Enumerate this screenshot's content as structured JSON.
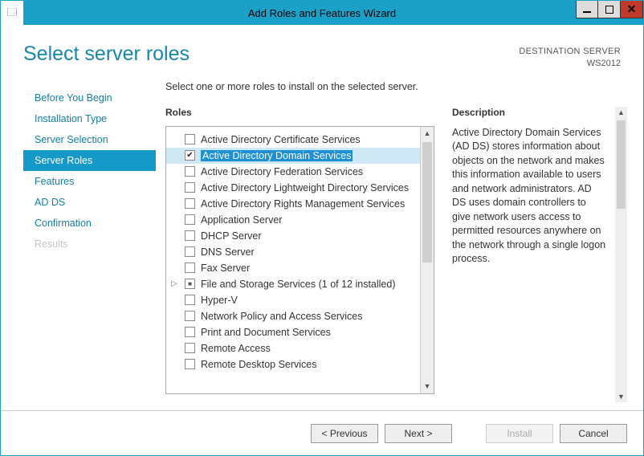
{
  "titlebar": {
    "title": "Add Roles and Features Wizard"
  },
  "header": {
    "page_title": "Select server roles",
    "destination_label": "DESTINATION SERVER",
    "destination_value": "WS2012"
  },
  "nav": {
    "items": [
      {
        "label": "Before You Begin",
        "active": false,
        "disabled": false
      },
      {
        "label": "Installation Type",
        "active": false,
        "disabled": false
      },
      {
        "label": "Server Selection",
        "active": false,
        "disabled": false
      },
      {
        "label": "Server Roles",
        "active": true,
        "disabled": false
      },
      {
        "label": "Features",
        "active": false,
        "disabled": false
      },
      {
        "label": "AD DS",
        "active": false,
        "disabled": false
      },
      {
        "label": "Confirmation",
        "active": false,
        "disabled": false
      },
      {
        "label": "Results",
        "active": false,
        "disabled": true
      }
    ]
  },
  "main": {
    "instruction": "Select one or more roles to install on the selected server.",
    "roles_label": "Roles",
    "description_label": "Description",
    "description_text": "Active Directory Domain Services (AD DS) stores information about objects on the network and makes this information available to users and network administrators. AD DS uses domain controllers to give network users access to permitted resources anywhere on the network through a single logon process.",
    "roles": [
      {
        "label": "Active Directory Certificate Services",
        "state": "unchecked",
        "selected": false,
        "expander": ""
      },
      {
        "label": "Active Directory Domain Services",
        "state": "checked",
        "selected": true,
        "expander": ""
      },
      {
        "label": "Active Directory Federation Services",
        "state": "unchecked",
        "selected": false,
        "expander": ""
      },
      {
        "label": "Active Directory Lightweight Directory Services",
        "state": "unchecked",
        "selected": false,
        "expander": ""
      },
      {
        "label": "Active Directory Rights Management Services",
        "state": "unchecked",
        "selected": false,
        "expander": ""
      },
      {
        "label": "Application Server",
        "state": "unchecked",
        "selected": false,
        "expander": ""
      },
      {
        "label": "DHCP Server",
        "state": "unchecked",
        "selected": false,
        "expander": ""
      },
      {
        "label": "DNS Server",
        "state": "unchecked",
        "selected": false,
        "expander": ""
      },
      {
        "label": "Fax Server",
        "state": "unchecked",
        "selected": false,
        "expander": ""
      },
      {
        "label": "File and Storage Services (1 of 12 installed)",
        "state": "indeterminate",
        "selected": false,
        "expander": "▷"
      },
      {
        "label": "Hyper-V",
        "state": "unchecked",
        "selected": false,
        "expander": ""
      },
      {
        "label": "Network Policy and Access Services",
        "state": "unchecked",
        "selected": false,
        "expander": ""
      },
      {
        "label": "Print and Document Services",
        "state": "unchecked",
        "selected": false,
        "expander": ""
      },
      {
        "label": "Remote Access",
        "state": "unchecked",
        "selected": false,
        "expander": ""
      },
      {
        "label": "Remote Desktop Services",
        "state": "unchecked",
        "selected": false,
        "expander": ""
      }
    ]
  },
  "footer": {
    "previous": "< Previous",
    "next": "Next >",
    "install": "Install",
    "cancel": "Cancel"
  }
}
